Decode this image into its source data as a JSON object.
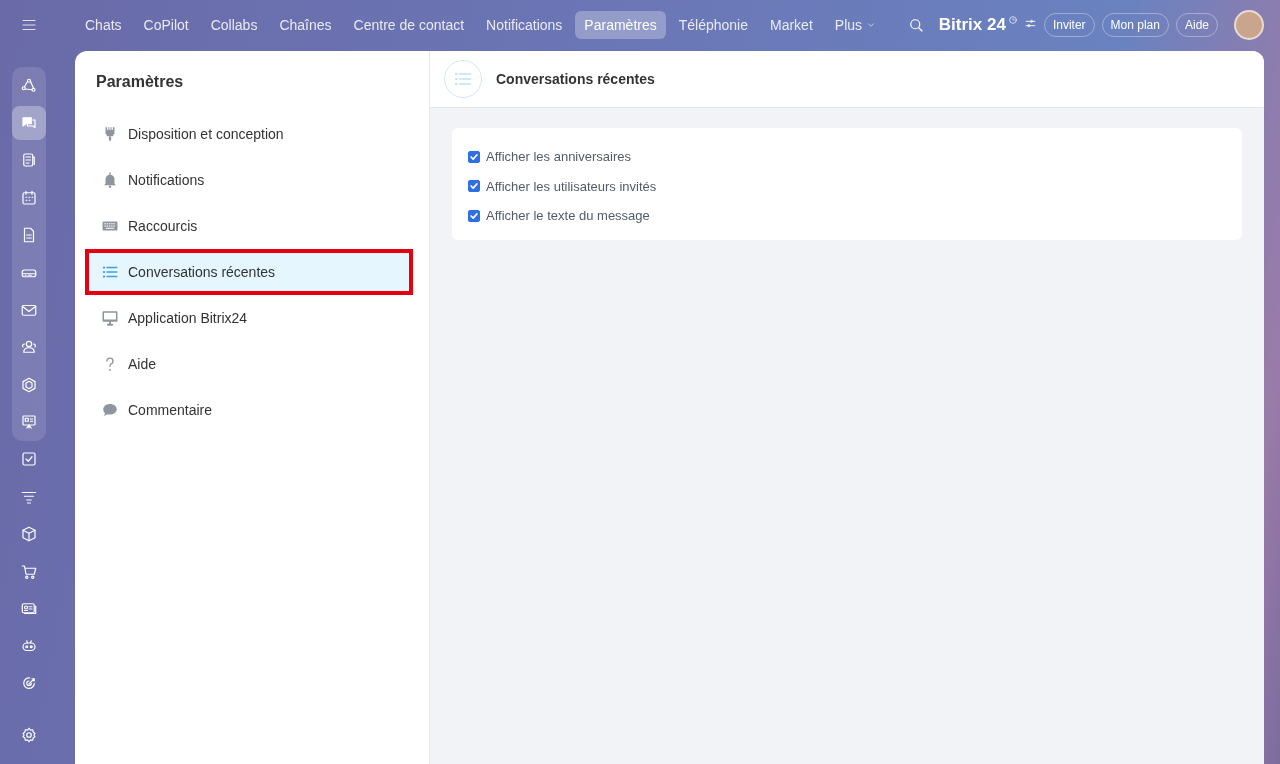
{
  "top_nav": {
    "tabs": [
      {
        "label": "Chats",
        "selected": false
      },
      {
        "label": "CoPilot",
        "selected": false
      },
      {
        "label": "Collabs",
        "selected": false
      },
      {
        "label": "Chaînes",
        "selected": false
      },
      {
        "label": "Centre de contact",
        "selected": false
      },
      {
        "label": "Notifications",
        "selected": false
      },
      {
        "label": "Paramètres",
        "selected": true
      },
      {
        "label": "Téléphonie",
        "selected": false
      },
      {
        "label": "Market",
        "selected": false
      }
    ],
    "more": {
      "label": "Plus"
    },
    "logo": {
      "text": "Bitrix 24"
    },
    "buttons": [
      "Inviter",
      "Mon plan",
      "Aide"
    ]
  },
  "rail_pinned": [
    {
      "selected": false
    },
    {
      "selected": true
    },
    {
      "selected": false
    },
    {
      "selected": false
    },
    {
      "selected": false
    },
    {
      "selected": false
    },
    {
      "selected": false
    },
    {
      "selected": false
    },
    {
      "selected": false
    },
    {
      "selected": false
    }
  ],
  "rail": [
    {
      "selected": false
    },
    {
      "selected": false
    },
    {
      "selected": false
    },
    {
      "selected": false
    },
    {
      "selected": false
    },
    {
      "selected": false
    },
    {
      "selected": false
    }
  ],
  "settings": {
    "title": "Paramètres",
    "items": [
      {
        "label": "Disposition et conception",
        "selected": false,
        "highlighted": false
      },
      {
        "label": "Notifications",
        "selected": false,
        "highlighted": false
      },
      {
        "label": "Raccourcis",
        "selected": false,
        "highlighted": false
      },
      {
        "label": "Conversations récentes",
        "selected": true,
        "highlighted": true
      },
      {
        "label": "Application Bitrix24",
        "selected": false,
        "highlighted": false
      },
      {
        "label": "Aide",
        "selected": false,
        "highlighted": false
      },
      {
        "label": "Commentaire",
        "selected": false,
        "highlighted": false
      }
    ],
    "section_title": "Conversations récentes",
    "options": [
      {
        "label": "Afficher les anniversaires",
        "checked": true
      },
      {
        "label": "Afficher les utilisateurs invités",
        "checked": true
      },
      {
        "label": "Afficher le texte du message",
        "checked": true
      }
    ]
  }
}
